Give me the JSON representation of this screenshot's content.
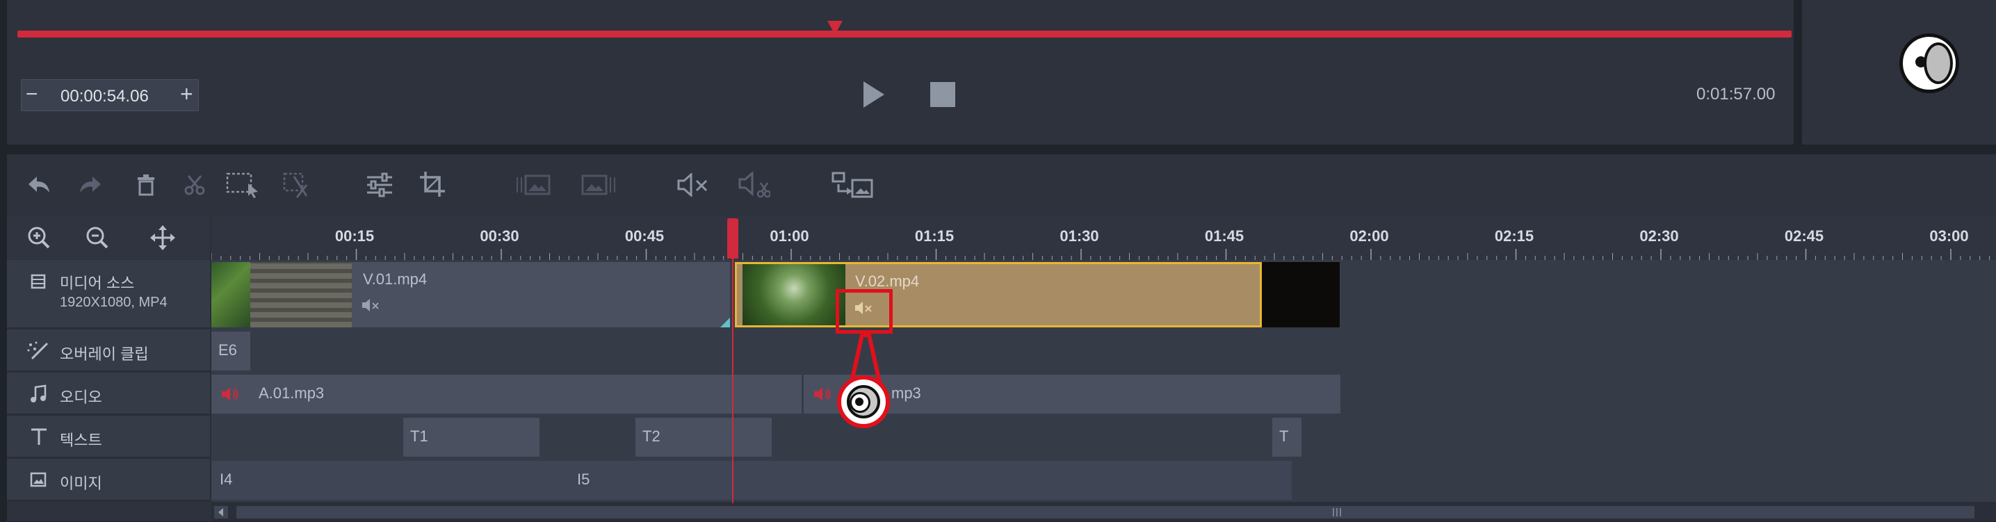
{
  "preview": {
    "current_time": "00:00:54.06",
    "total_time": "0:01:57.00",
    "minus_label": "−",
    "plus_label": "+",
    "progress": 0.4595
  },
  "toolbar": {
    "icons": [
      "undo-icon",
      "redo-icon",
      "delete-icon",
      "cut-icon",
      "select-icon",
      "split-icon",
      "adjust-icon",
      "crop-icon",
      "image-left-icon",
      "image-right-icon",
      "mute-icon",
      "audio-split-icon",
      "replace-icon"
    ]
  },
  "timeline": {
    "ticks": [
      "00:15",
      "00:30",
      "00:45",
      "01:00",
      "01:15",
      "01:30",
      "01:45",
      "02:00",
      "02:15",
      "02:30",
      "02:45",
      "03:00"
    ],
    "playhead_time": "00:54"
  },
  "tracks": {
    "media": {
      "label": "미디어 소스",
      "sub": "1920X1080, MP4"
    },
    "overlay": {
      "label": "오버레이 클립"
    },
    "audio": {
      "label": "오디오"
    },
    "text": {
      "label": "텍스트"
    },
    "image": {
      "label": "이미지"
    }
  },
  "clips": {
    "video1": "V.01.mp4",
    "video2": "V.02.mp4",
    "overlay1": "E6",
    "audio1": "A.01.mp3",
    "audio2": "mp3",
    "text1": "T1",
    "text2": "T2",
    "text3": "T",
    "image1": "I4",
    "image2": "I5"
  },
  "colors": {
    "accent_red": "#d02a3c",
    "selected_clip": "#a88c64",
    "selected_border": "#e8b830"
  }
}
